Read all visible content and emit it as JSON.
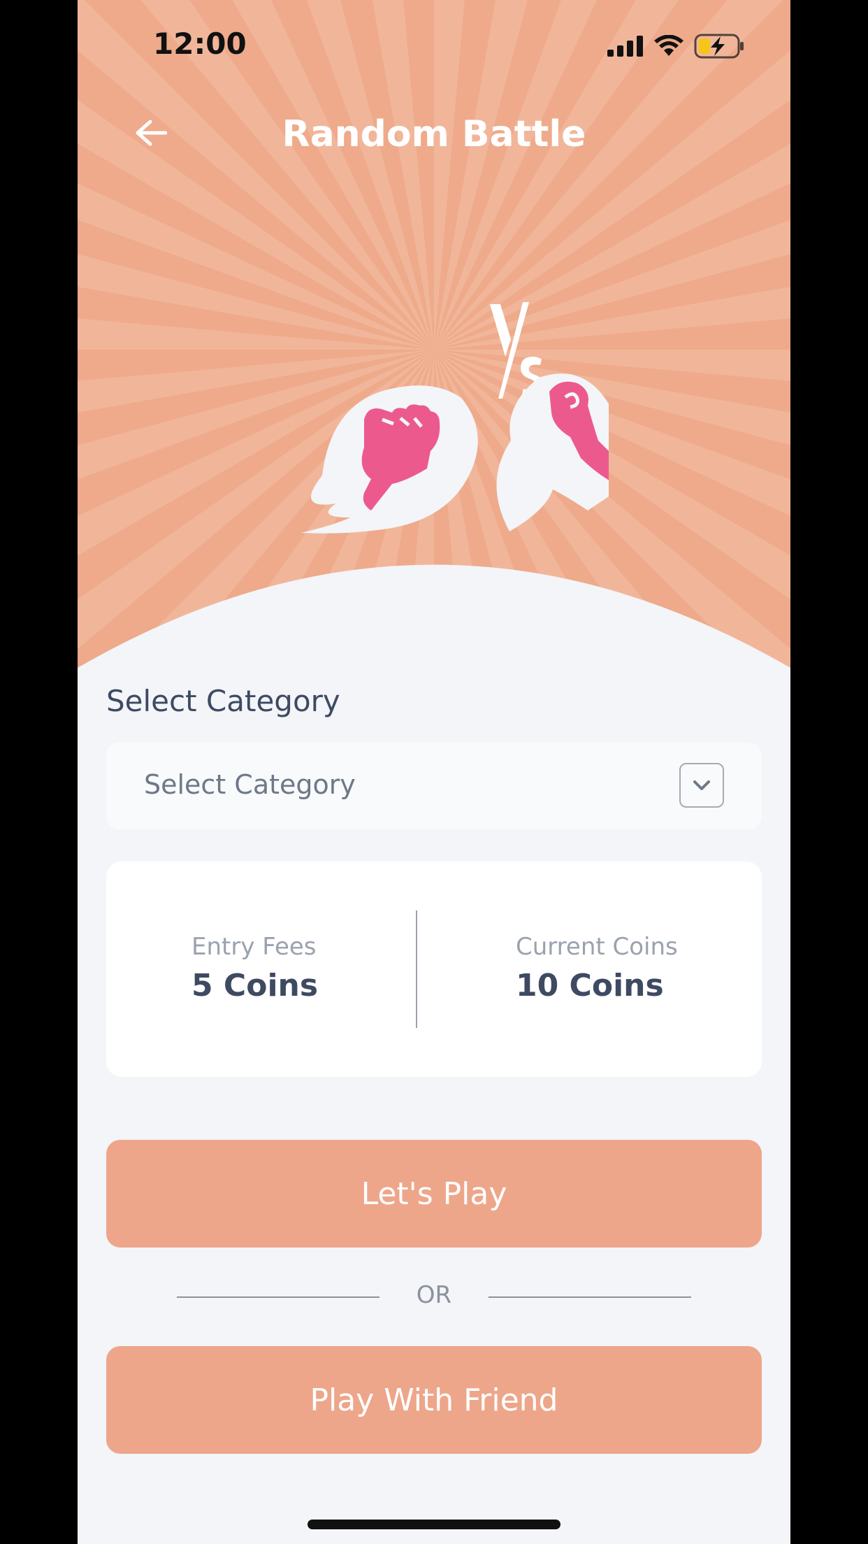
{
  "status_bar": {
    "time": "12:00"
  },
  "header": {
    "title": "Random Battle"
  },
  "category": {
    "label": "Select Category",
    "dropdown_value": "Select Category"
  },
  "fees": {
    "entry_label": "Entry Fees",
    "entry_value": "5 Coins",
    "current_label": "Current Coins",
    "current_value": "10 Coins"
  },
  "actions": {
    "play_label": "Let's Play",
    "or_label": "OR",
    "friend_label": "Play With Friend"
  },
  "colors": {
    "accent": "#eda68a",
    "hero_bg": "#eeaa8a",
    "fist_pink": "#ec5a8d",
    "text_dark": "#3e4a62",
    "page_bg": "#f3f5f9"
  }
}
